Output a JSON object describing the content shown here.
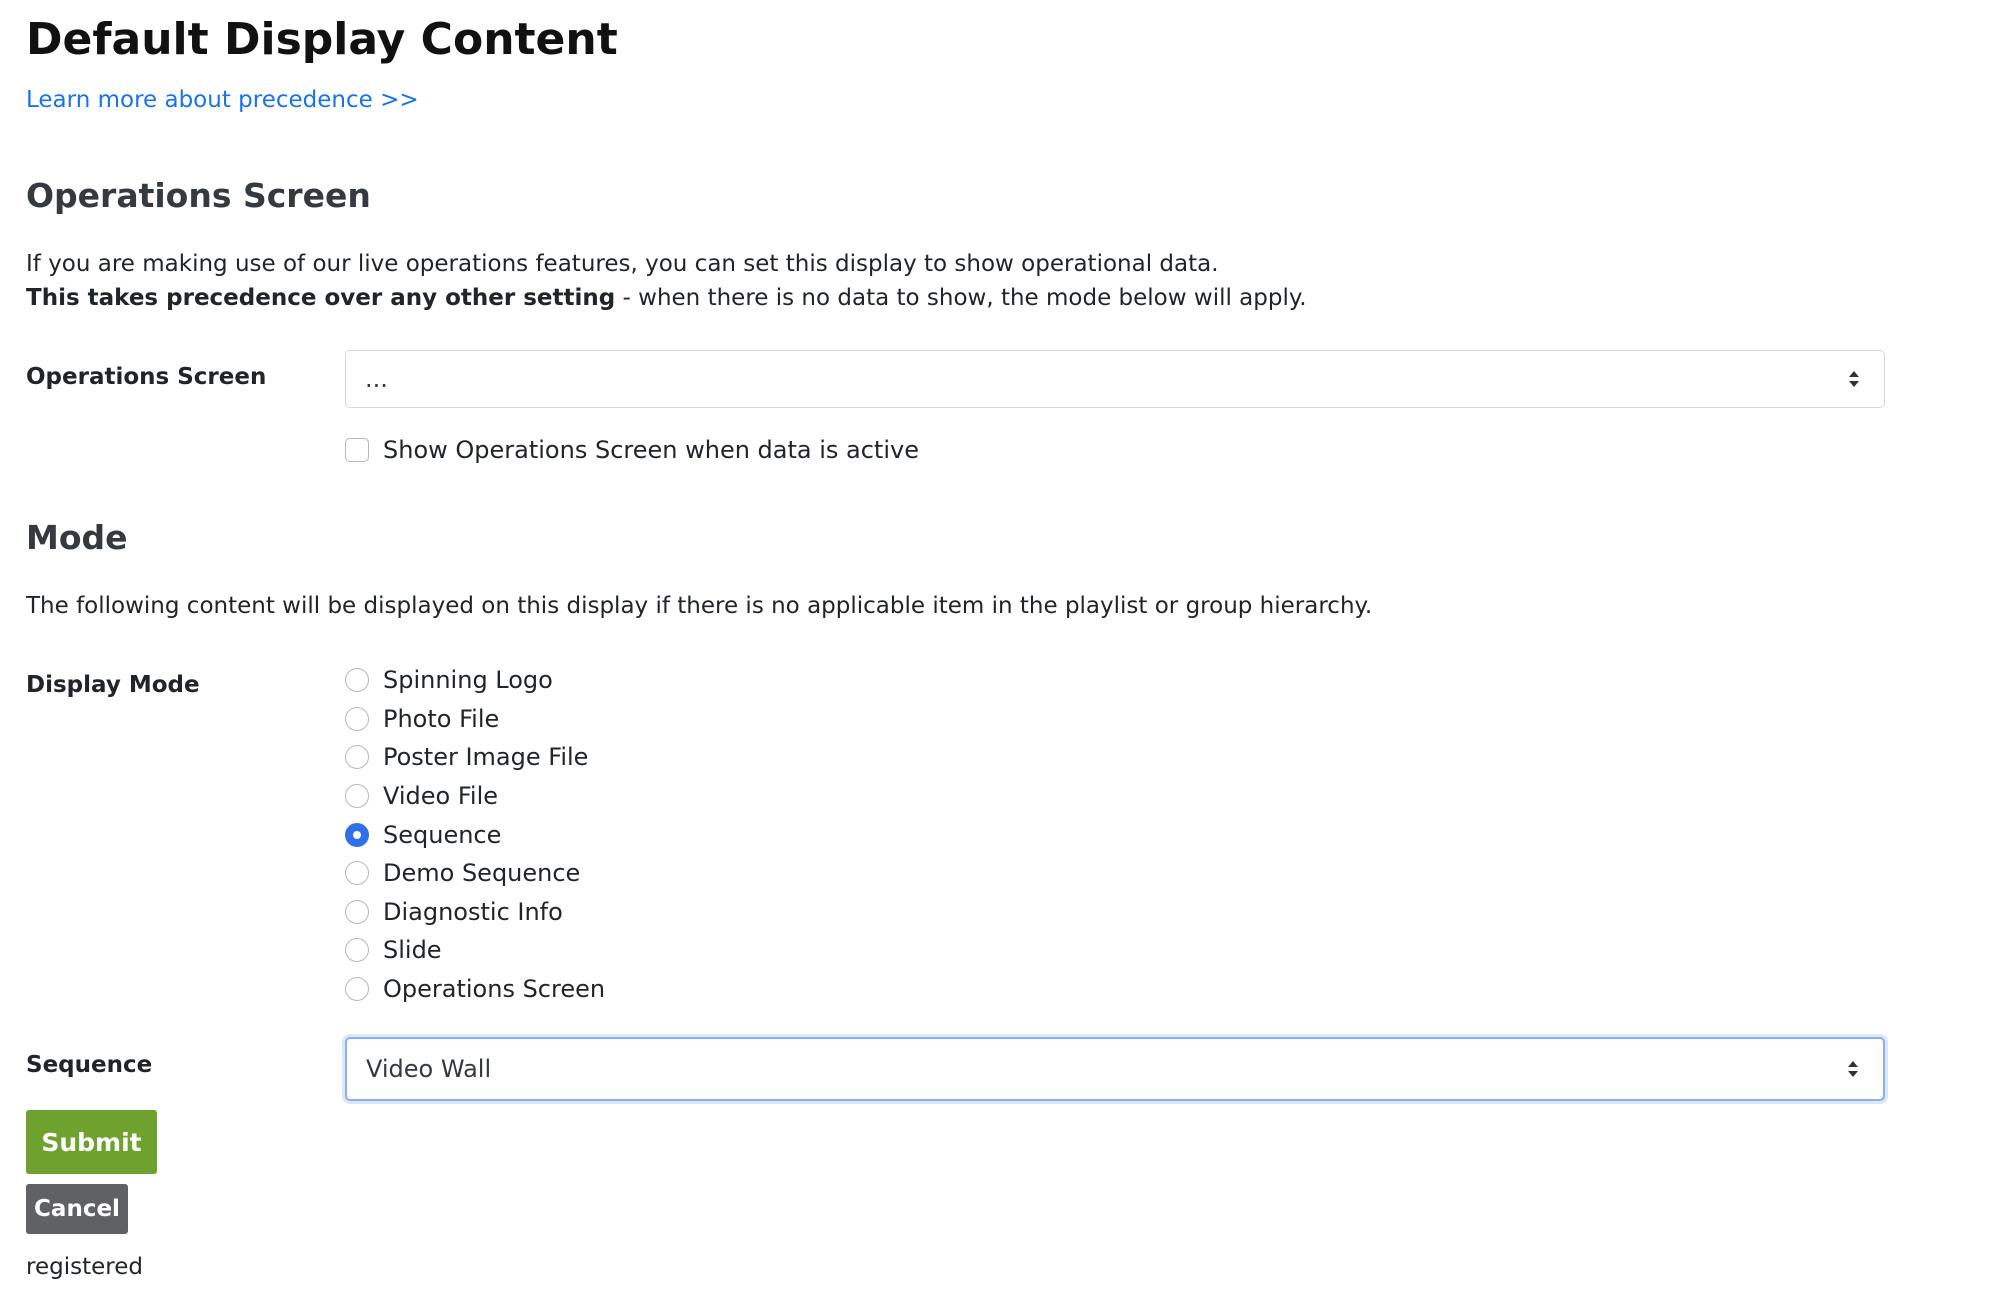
{
  "page_title": "Default Display Content",
  "precedence_link": "Learn more about precedence >>",
  "operations_section": {
    "heading": "Operations Screen",
    "description_line1": "If you are making use of our live operations features, you can set this display to show operational data.",
    "description_bold": "This takes precedence over any other setting",
    "description_rest": " - when there is no data to show, the mode below will apply.",
    "field_label": "Operations Screen",
    "select_value": "...",
    "checkbox_label": "Show Operations Screen when data is active",
    "checkbox_checked": false
  },
  "mode_section": {
    "heading": "Mode",
    "description": "The following content will be displayed on this display if there is no applicable item in the playlist or group hierarchy.",
    "display_mode_label": "Display Mode",
    "options": [
      {
        "label": "Spinning Logo",
        "checked": false
      },
      {
        "label": "Photo File",
        "checked": false
      },
      {
        "label": "Poster Image File",
        "checked": false
      },
      {
        "label": "Video File",
        "checked": false
      },
      {
        "label": "Sequence",
        "checked": true
      },
      {
        "label": "Demo Sequence",
        "checked": false
      },
      {
        "label": "Diagnostic Info",
        "checked": false
      },
      {
        "label": "Slide",
        "checked": false
      },
      {
        "label": "Operations Screen",
        "checked": false
      }
    ],
    "sequence_label": "Sequence",
    "sequence_value": "Video Wall"
  },
  "buttons": {
    "submit": "Submit",
    "cancel": "Cancel"
  },
  "status_text": "registered",
  "colors": {
    "link": "#1a73e8",
    "radio_checked": "#2f6fe8",
    "submit_bg": "#6fa12f",
    "cancel_bg": "#5f6164"
  }
}
